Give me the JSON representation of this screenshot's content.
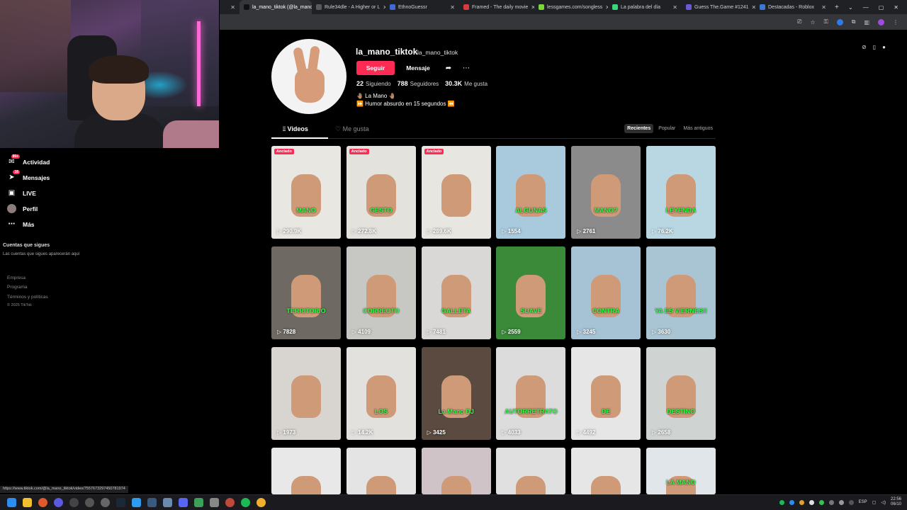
{
  "browser": {
    "tabs": [
      {
        "label": "la_mano_tiktok (@la_mano",
        "color": "#111111",
        "active": true
      },
      {
        "label": "Rule34dle - A Higher or L",
        "color": "#5a5a5a",
        "active": false
      },
      {
        "label": "EthnoGuessr",
        "color": "#3d6bd6",
        "active": false
      },
      {
        "label": "Framed - The daily movie",
        "color": "#d63a3a",
        "active": false
      },
      {
        "label": "lessgames.com/songless",
        "color": "#7ad63a",
        "active": false
      },
      {
        "label": "La palabra del día",
        "color": "#3ad67a",
        "active": false
      },
      {
        "label": "Guess The.Game #1241",
        "color": "#6a5ad6",
        "active": false
      },
      {
        "label": "Destacadas - Roblox",
        "color": "#3a7ad6",
        "active": false
      }
    ],
    "status_url": "https://www.tiktok.com/@la_mano_tiktok/video/7557673297450781974"
  },
  "nav": {
    "items": [
      {
        "label": "Actividad",
        "icon": "activity-icon",
        "badge": "99+"
      },
      {
        "label": "Mensajes",
        "icon": "messages-icon",
        "badge": "16"
      },
      {
        "label": "LIVE",
        "icon": "live-icon",
        "badge": ""
      },
      {
        "label": "Perfil",
        "icon": "avatar",
        "badge": ""
      },
      {
        "label": "Más",
        "icon": "more-icon",
        "badge": ""
      }
    ],
    "following_heading": "Cuentas que sigues",
    "following_empty": "Las cuentas que sigues aparecerán aquí",
    "footer": [
      "Empresa",
      "Programa",
      "Términos y políticas",
      "© 2025 TikTok"
    ]
  },
  "profile": {
    "username": "la_mano_tiktok",
    "nickname": "la_mano_tiktok",
    "follow_label": "Seguir",
    "message_label": "Mensaje",
    "stats": [
      {
        "value": "22",
        "label": "Siguiendo"
      },
      {
        "value": "788",
        "label": "Seguidores"
      },
      {
        "value": "30.3K",
        "label": "Me gusta"
      }
    ],
    "bio_line1": "🤚🏽 La Mano 🤚🏽",
    "bio_line2": "⏩ Humor absurdo en 15 segundos ⏪"
  },
  "tabs": {
    "videos_label": "Videos",
    "liked_label": "Me gusta",
    "sort_options": [
      "Recientes",
      "Popular",
      "Más antiguos"
    ]
  },
  "videos": [
    {
      "views": "290.9K",
      "caption": "MANO",
      "pinned": "Anclado",
      "bg": "#e9e7e2"
    },
    {
      "views": "272.8K",
      "caption": "GESTO",
      "pinned": "Anclado",
      "bg": "#e4e2dd"
    },
    {
      "views": "289.6K",
      "caption": "",
      "pinned": "Anclado",
      "bg": "#e8e6e1"
    },
    {
      "views": "1554",
      "caption": "ALGUNAS",
      "pinned": "",
      "bg": "#a9c9dd"
    },
    {
      "views": "2761",
      "caption": "MANO?",
      "pinned": "",
      "bg": "#8b8b8b"
    },
    {
      "views": "76.2K",
      "caption": "LEYENDA",
      "pinned": "",
      "bg": "#b9d7e3"
    },
    {
      "views": "7828",
      "caption": "TERRITORIO",
      "pinned": "",
      "bg": "#6e6a63"
    },
    {
      "views": "4109",
      "caption": "CORRECTO",
      "pinned": "",
      "bg": "#c7c7c4"
    },
    {
      "views": "7481",
      "caption": "GALLETA",
      "pinned": "",
      "bg": "#d9d8d6"
    },
    {
      "views": "2559",
      "caption": "SUAVE",
      "pinned": "",
      "bg": "#3a8a3a"
    },
    {
      "views": "3245",
      "caption": "CONTRA",
      "pinned": "",
      "bg": "#a6c3d6"
    },
    {
      "views": "3630",
      "caption": "YA ES VIERNES!!",
      "pinned": "",
      "bg": "#a9c5d3"
    },
    {
      "views": "1973",
      "caption": "",
      "pinned": "",
      "bg": "#d8d5d0"
    },
    {
      "views": "14.2K",
      "caption": "LOS",
      "pinned": "",
      "bg": "#e2e1de"
    },
    {
      "views": "3425",
      "caption": "La Mano DJ",
      "pinned": "",
      "bg": "#5a4a40"
    },
    {
      "views": "4033",
      "caption": "AUTORRETRATO",
      "pinned": "",
      "bg": "#dcdcdc"
    },
    {
      "views": "4492",
      "caption": "DE",
      "pinned": "",
      "bg": "#e6e6e6"
    },
    {
      "views": "2658",
      "caption": "DESTINO",
      "pinned": "",
      "bg": "#cfd4d2"
    },
    {
      "views": "",
      "caption": "",
      "pinned": "",
      "bg": "#e8e8e8"
    },
    {
      "views": "",
      "caption": "",
      "pinned": "",
      "bg": "#e4e4e4"
    },
    {
      "views": "",
      "caption": "",
      "pinned": "",
      "bg": "#cfc3c7"
    },
    {
      "views": "",
      "caption": "",
      "pinned": "",
      "bg": "#e0e0e0"
    },
    {
      "views": "",
      "caption": "",
      "pinned": "",
      "bg": "#e6e6e6"
    },
    {
      "views": "",
      "caption": "LA MANO",
      "pinned": "",
      "bg": "#e1e6ea"
    }
  ],
  "taskbar": {
    "lang": "ESP",
    "time": "22:56",
    "date": "06/10"
  }
}
